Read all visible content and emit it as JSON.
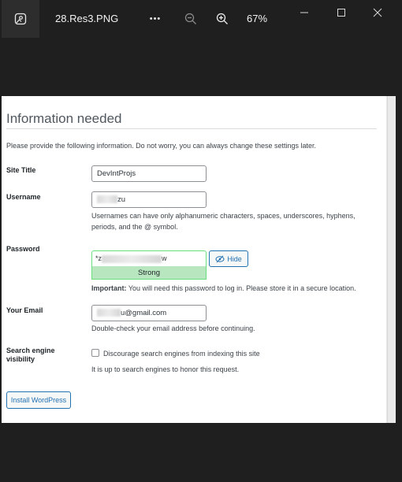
{
  "viewer": {
    "file_name": "28.Res3.PNG",
    "more_label": "•••",
    "zoom_level": "67%"
  },
  "page": {
    "title": "Information needed",
    "intro": "Please provide the following information. Do not worry, you can always change these settings later."
  },
  "site_title": {
    "label": "Site Title",
    "value": "DevIntProjs"
  },
  "username": {
    "label": "Username",
    "value_visible": "zu",
    "hint_line1": "Usernames can have only alphanumeric characters, spaces, underscores, hyphens,",
    "hint_line2": "periods, and the @ symbol."
  },
  "password": {
    "label": "Password",
    "value_prefix": "*z",
    "value_suffix": "w",
    "strength": "Strong",
    "hide_label": "Hide",
    "important_bold": "Important:",
    "important_text": " You will need this password to log in. Please store it in a secure location."
  },
  "email": {
    "label": "Your Email",
    "value_visible": "u@gmail.com",
    "hint": "Double-check your email address before continuing."
  },
  "search_visibility": {
    "label_line1": "Search engine",
    "label_line2": "visibility",
    "checkbox_label": "Discourage search engines from indexing this site",
    "checked": false,
    "hint": "It is up to search engines to honor this request."
  },
  "install_button": "Install WordPress"
}
